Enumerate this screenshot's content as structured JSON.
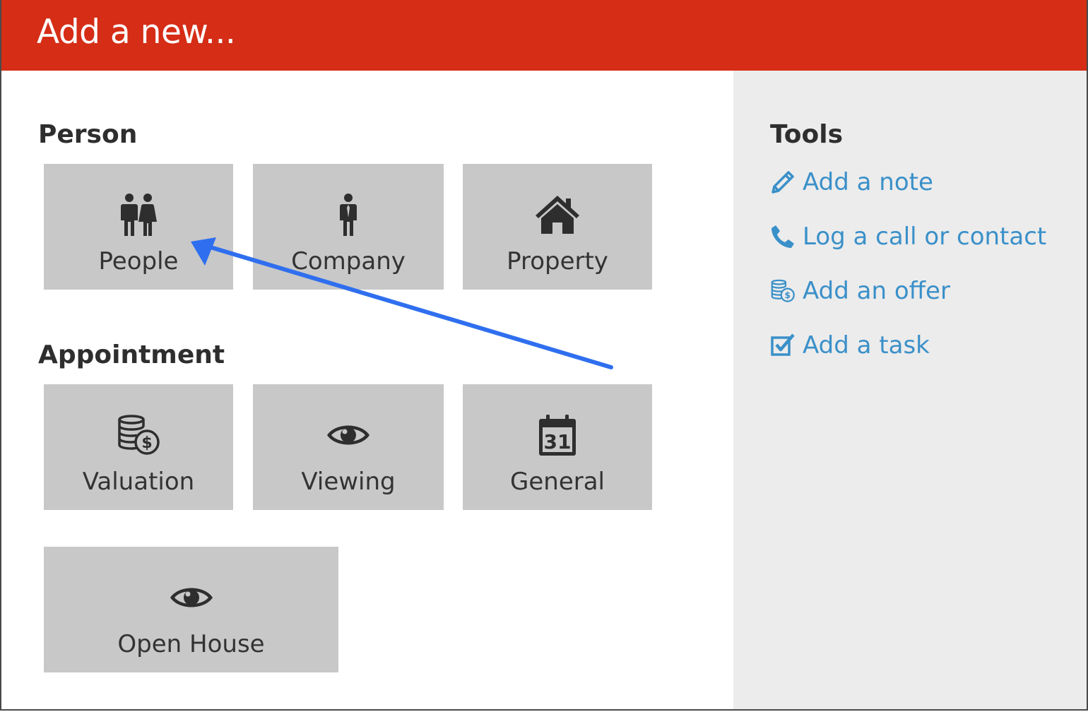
{
  "header": {
    "title": "Add a new..."
  },
  "person": {
    "title": "Person",
    "tiles": [
      {
        "label": "People",
        "icon": "people-icon"
      },
      {
        "label": "Company",
        "icon": "businessman-icon"
      },
      {
        "label": "Property",
        "icon": "house-icon"
      }
    ]
  },
  "appointment": {
    "title": "Appointment",
    "tiles": [
      {
        "label": "Valuation",
        "icon": "coins-dollar-icon"
      },
      {
        "label": "Viewing",
        "icon": "eye-icon"
      },
      {
        "label": "General",
        "icon": "calendar-icon"
      },
      {
        "label": "Open House",
        "icon": "eye-icon"
      }
    ]
  },
  "tools": {
    "title": "Tools",
    "items": [
      {
        "label": "Add a note",
        "icon": "pencil-icon"
      },
      {
        "label": "Log a call or contact",
        "icon": "phone-icon"
      },
      {
        "label": "Add an offer",
        "icon": "coins-dollar-icon"
      },
      {
        "label": "Add a task",
        "icon": "checkbox-icon"
      }
    ]
  },
  "colors": {
    "header_bg": "#d52d16",
    "tile_bg": "#c8c8c8",
    "tools_bg": "#ececec",
    "link": "#3a90c9",
    "annotation_arrow": "#2f6fef"
  }
}
